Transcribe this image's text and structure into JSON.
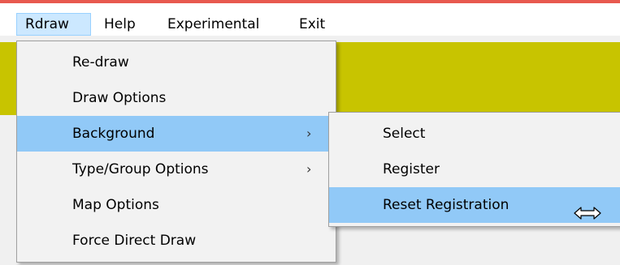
{
  "menubar": {
    "items": [
      {
        "label": "Rdraw"
      },
      {
        "label": "Help"
      },
      {
        "label": "Experimental"
      },
      {
        "label": "Exit"
      }
    ]
  },
  "rdraw_menu": {
    "items": [
      {
        "label": "Re-draw"
      },
      {
        "label": "Draw Options"
      },
      {
        "label": "Background",
        "submenu_arrow": "›"
      },
      {
        "label": "Type/Group Options",
        "submenu_arrow": "›"
      },
      {
        "label": "Map Options"
      },
      {
        "label": "Force Direct Draw"
      }
    ]
  },
  "background_submenu": {
    "items": [
      {
        "label": "Select"
      },
      {
        "label": "Register"
      },
      {
        "label": "Reset Registration"
      }
    ]
  },
  "cursor": {
    "icon": "horizontal-resize-cursor-icon"
  },
  "colors": {
    "title_accent": "#e8594f",
    "client_fill": "#c8c400",
    "menu_bg": "#f2f2f2",
    "highlight": "#91c9f7",
    "menubar_active": "#cce8ff"
  }
}
